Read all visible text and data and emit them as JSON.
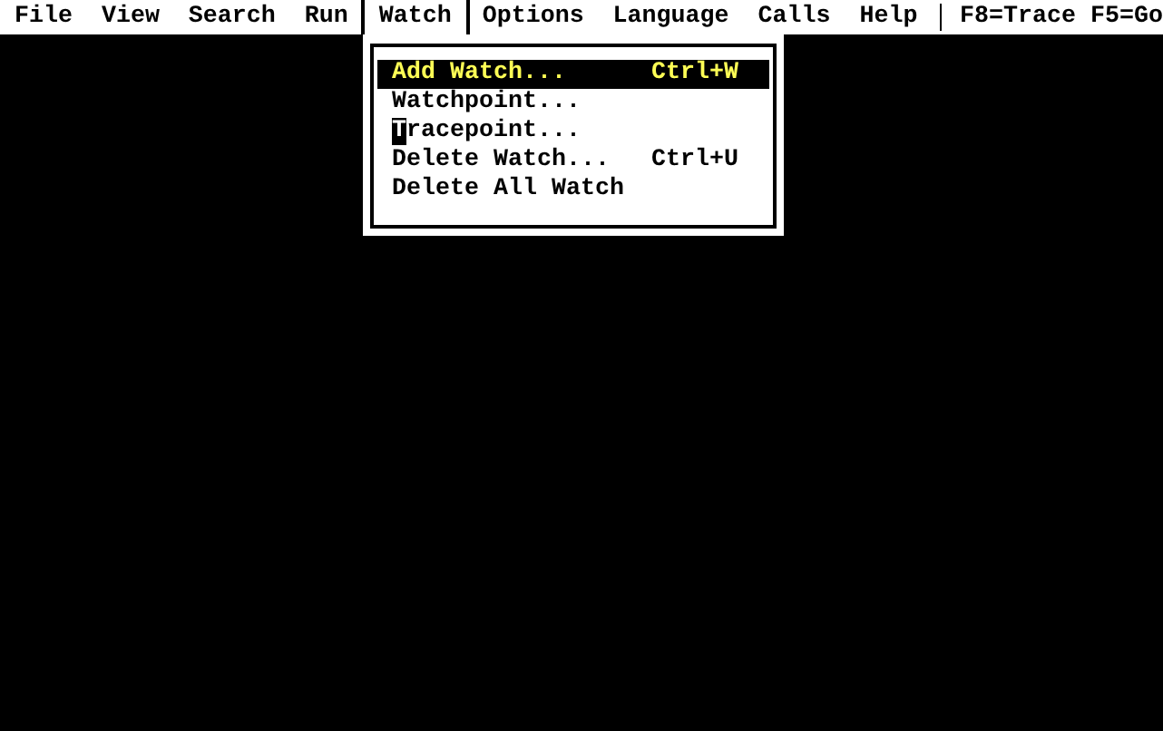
{
  "menu_bar": {
    "items": [
      {
        "label": "File",
        "selected": false
      },
      {
        "label": "View",
        "selected": false
      },
      {
        "label": "Search",
        "selected": false
      },
      {
        "label": "Run",
        "selected": false
      },
      {
        "label": "Watch",
        "selected": true
      },
      {
        "label": "Options",
        "selected": false
      },
      {
        "label": "Language",
        "selected": false
      },
      {
        "label": "Calls",
        "selected": false
      },
      {
        "label": "Help",
        "selected": false
      }
    ],
    "hint": "F8=Trace F5=Go"
  },
  "dropdown": {
    "items": [
      {
        "label": "Add Watch...",
        "shortcut": "Ctrl+W",
        "selected": true,
        "cursor": false
      },
      {
        "label": "Watchpoint...",
        "selected": false,
        "cursor": false
      },
      {
        "label": "Tracepoint...",
        "selected": false,
        "cursor": true
      },
      {
        "label": "Delete Watch...",
        "shortcut": "Ctrl+U",
        "selected": false,
        "cursor": false
      },
      {
        "label": "Delete All Watch",
        "selected": false,
        "cursor": false
      }
    ]
  }
}
